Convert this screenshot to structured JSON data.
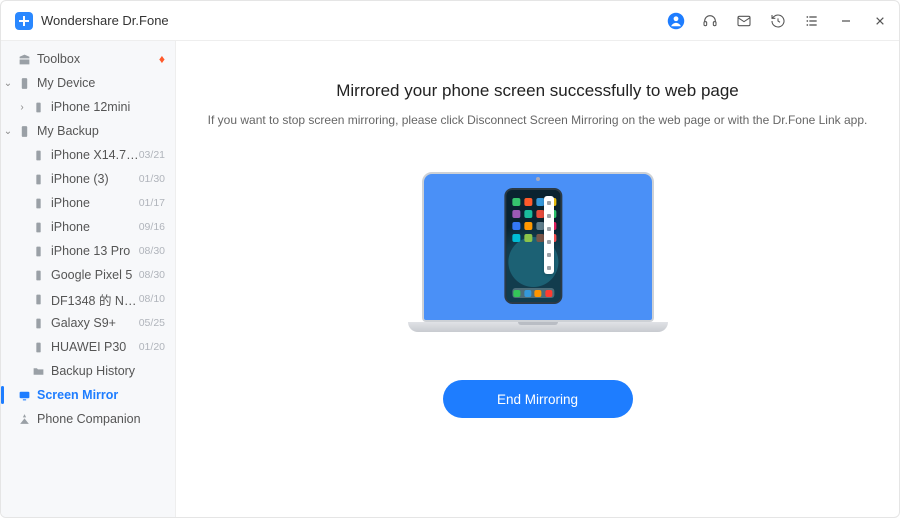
{
  "app_title": "Wondershare Dr.Fone",
  "sidebar": {
    "toolbox": "Toolbox",
    "my_device": "My Device",
    "device_0": "iPhone 12mini",
    "my_backup": "My Backup",
    "backups": [
      {
        "name": "iPhone X14.7-...",
        "date": "03/21"
      },
      {
        "name": "iPhone (3)",
        "date": "01/30"
      },
      {
        "name": "iPhone",
        "date": "01/17"
      },
      {
        "name": "iPhone",
        "date": "09/16"
      },
      {
        "name": "iPhone 13 Pro",
        "date": "08/30"
      },
      {
        "name": "Google Pixel 5",
        "date": "08/30"
      },
      {
        "name": "DF1348 的 Not...",
        "date": "08/10"
      },
      {
        "name": "Galaxy S9+",
        "date": "05/25"
      },
      {
        "name": "HUAWEI P30",
        "date": "01/20"
      }
    ],
    "backup_history": "Backup History",
    "screen_mirror": "Screen Mirror",
    "phone_companion": "Phone Companion"
  },
  "main": {
    "heading": "Mirrored your phone screen successfully to web page",
    "sub": "If you want to stop screen mirroring, please click Disconnect Screen Mirroring on the web page or with the Dr.Fone Link app.",
    "end_button": "End Mirroring"
  },
  "app_colors": [
    "#36c46e",
    "#ff5a2b",
    "#3498db",
    "#f1c40f",
    "#9b59b6",
    "#1abc9c",
    "#e74c3c",
    "#2ecc71",
    "#3478f6",
    "#ff9800",
    "#607d8b",
    "#e91e63",
    "#00bcd4",
    "#8bc34a",
    "#795548",
    "#ff5252"
  ],
  "dock_colors": [
    "#34c759",
    "#3498db",
    "#ff9500",
    "#ff3b30"
  ]
}
